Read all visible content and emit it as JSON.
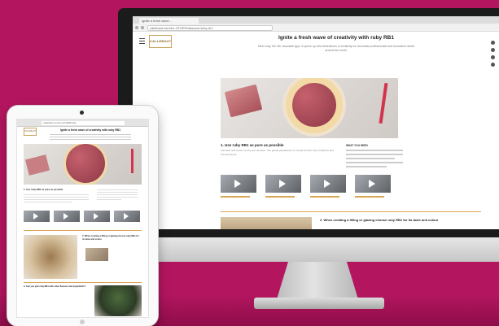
{
  "imac": {
    "tab_title": "Ignite a fresh wave...",
    "url": "callebaut.com/en-OTHER/discover/ruby-rb1",
    "logo_text": "CALLEBAUT",
    "page_title": "Ignite a fresh wave of creativity with ruby RB1",
    "intro_text": "Meet ruby, the 4th chocolate type. It opens up new dimensions of creativity for chocolate professionals and innovative minds around the world.",
    "section1_title": "1. Use ruby RB1 as pure as possible",
    "section1_text": "The taste and colour of ruby are sensitive. Use gentle preparations to reveal its fresh berry-fruitiness and intense flavour.",
    "side_title": "WHAT YOU NEED",
    "section2_title": "2. When creating a filling or glazing choose ruby RB1 for its taste and colour"
  },
  "ipad": {
    "url": "callebaut.com/en-OTHER/ruby",
    "logo_text": "CALLEBAUT",
    "page_title": "Ignite a fresh wave of creativity with ruby RB1",
    "section1_title": "1. Use ruby RB1 as pure as possible",
    "section2_title": "2. When creating a filling or glazing choose ruby RB1 for its taste and colour",
    "section3_title": "3. Can you pair ruby RB1 with other flavours and ingredients?"
  },
  "colors": {
    "background": "#b3165f",
    "accent_gold": "#d9a654",
    "ruby": "#a54a57"
  }
}
